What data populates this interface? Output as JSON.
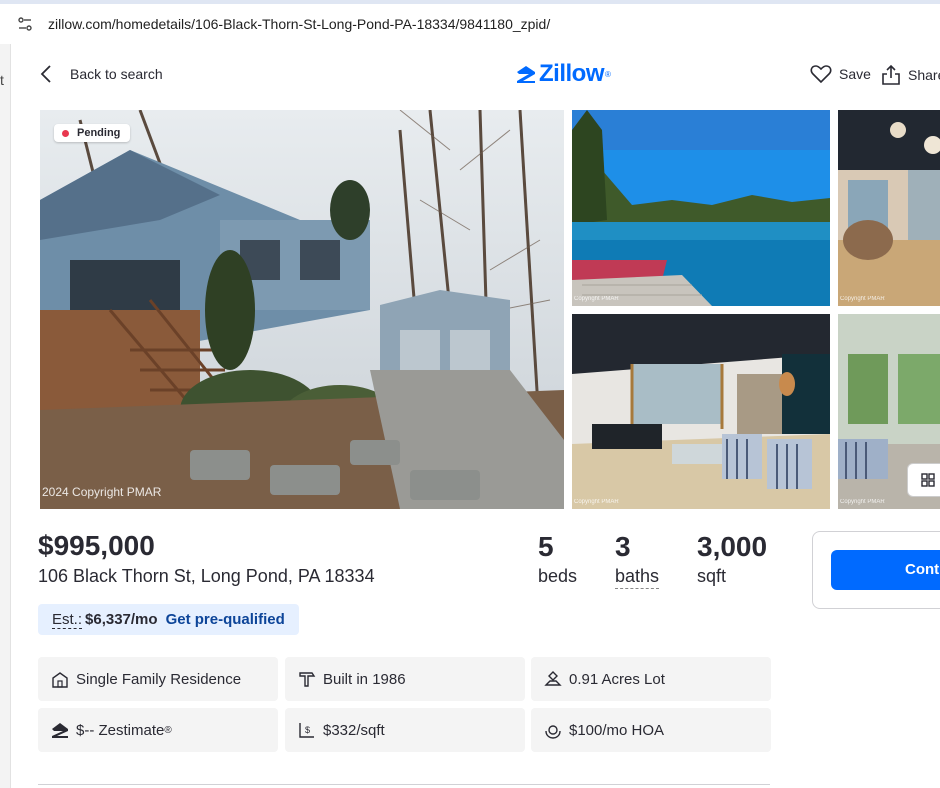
{
  "browser": {
    "url": "zillow.com/homedetails/106-Black-Thorn-St-Long-Pond-PA-18334/9841180_zpid/",
    "left_edge_text": "t"
  },
  "nav": {
    "back_label": "Back to search",
    "logo_text": "Zillow",
    "logo_reg": "®",
    "save_label": "Save",
    "share_label": "Share"
  },
  "photos": {
    "status_badge": "Pending",
    "main_copyright": "2024 Copyright PMAR",
    "thumb_copyright": "Copyright PMAR"
  },
  "listing": {
    "price": "$995,000",
    "address": "106 Black Thorn St, Long Pond, PA 18334",
    "beds_num": "5",
    "beds_label": "beds",
    "baths_num": "3",
    "baths_label": "baths",
    "sqft_num": "3,000",
    "sqft_label": "sqft"
  },
  "contact": {
    "button_label": "Cont"
  },
  "estimate": {
    "label": "Est.:",
    "value": "$6,337/mo",
    "link": "Get pre-qualified"
  },
  "facts": {
    "type": "Single Family Residence",
    "built": "Built in 1986",
    "lot": "0.91 Acres Lot",
    "zestimate": "$-- Zestimate",
    "zestimate_reg": "®",
    "price_sqft": "$332/sqft",
    "hoa": "$100/mo HOA"
  },
  "colors": {
    "brand": "#006aff",
    "badge_dot": "#e8384f",
    "est_bg": "#e6f0ff",
    "link": "#0d4599"
  }
}
